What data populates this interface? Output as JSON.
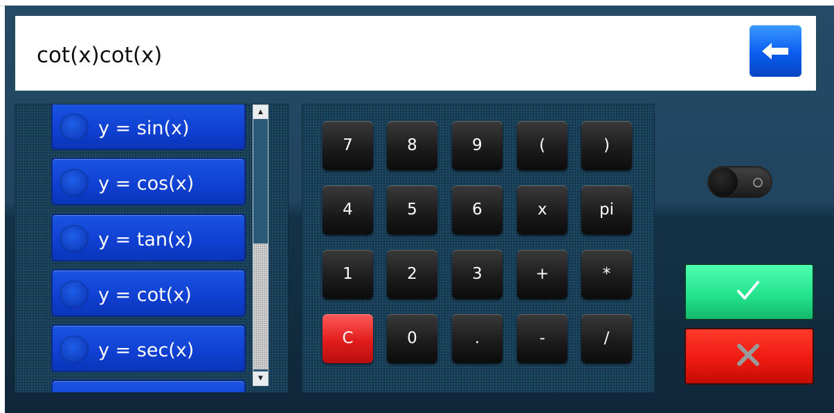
{
  "expression": {
    "value": "cot(x)cot(x)"
  },
  "back_button": {
    "icon": "arrow-left-icon"
  },
  "function_list": {
    "items": [
      {
        "label": "y = sin(x)"
      },
      {
        "label": "y = cos(x)"
      },
      {
        "label": "y = tan(x)"
      },
      {
        "label": "y = cot(x)"
      },
      {
        "label": "y = sec(x)"
      }
    ]
  },
  "keypad": {
    "rows": [
      [
        "7",
        "8",
        "9",
        "(",
        ")"
      ],
      [
        "4",
        "5",
        "6",
        "x",
        "pi"
      ],
      [
        "1",
        "2",
        "3",
        "+",
        "*"
      ],
      [
        "C",
        "0",
        ".",
        "-",
        "/"
      ]
    ]
  },
  "toggle": {
    "state": "off"
  },
  "actions": {
    "confirm_icon": "checkmark-icon",
    "cancel_icon": "close-icon"
  },
  "colors": {
    "accent_blue": "#0f3fd2",
    "confirm_green": "#22e08a",
    "cancel_red": "#ef1a10",
    "clear_red": "#e21c1c"
  }
}
